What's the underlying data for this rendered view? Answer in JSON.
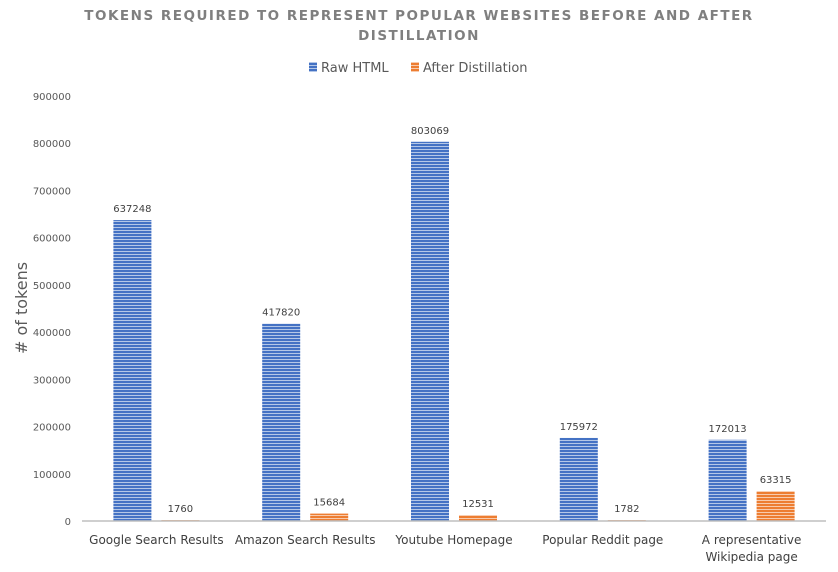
{
  "chart_data": {
    "type": "bar",
    "title": "TOKENS REQUIRED TO REPRESENT POPULAR WEBSITES BEFORE AND AFTER DISTILLATION",
    "title_lines": [
      "TOKENS REQUIRED TO REPRESENT POPULAR WEBSITES BEFORE AND AFTER",
      "DISTILLATION"
    ],
    "xlabel": "",
    "ylabel": "# of tokens",
    "ylim": [
      0,
      900000
    ],
    "yticks": [
      0,
      100000,
      200000,
      300000,
      400000,
      500000,
      600000,
      700000,
      800000,
      900000
    ],
    "grid": false,
    "legend_position": "top-center",
    "categories": [
      [
        "Google Search Results"
      ],
      [
        "Amazon Search Results"
      ],
      [
        "Youtube Homepage"
      ],
      [
        "Popular Reddit page"
      ],
      [
        "A representative",
        "Wikipedia page"
      ]
    ],
    "series": [
      {
        "name": "Raw HTML",
        "color": "#4472c4",
        "values": [
          637248,
          417820,
          803069,
          175972,
          172013
        ]
      },
      {
        "name": "After Distillation",
        "color": "#ed7d31",
        "values": [
          1760,
          15684,
          12531,
          1782,
          63315
        ]
      }
    ]
  }
}
